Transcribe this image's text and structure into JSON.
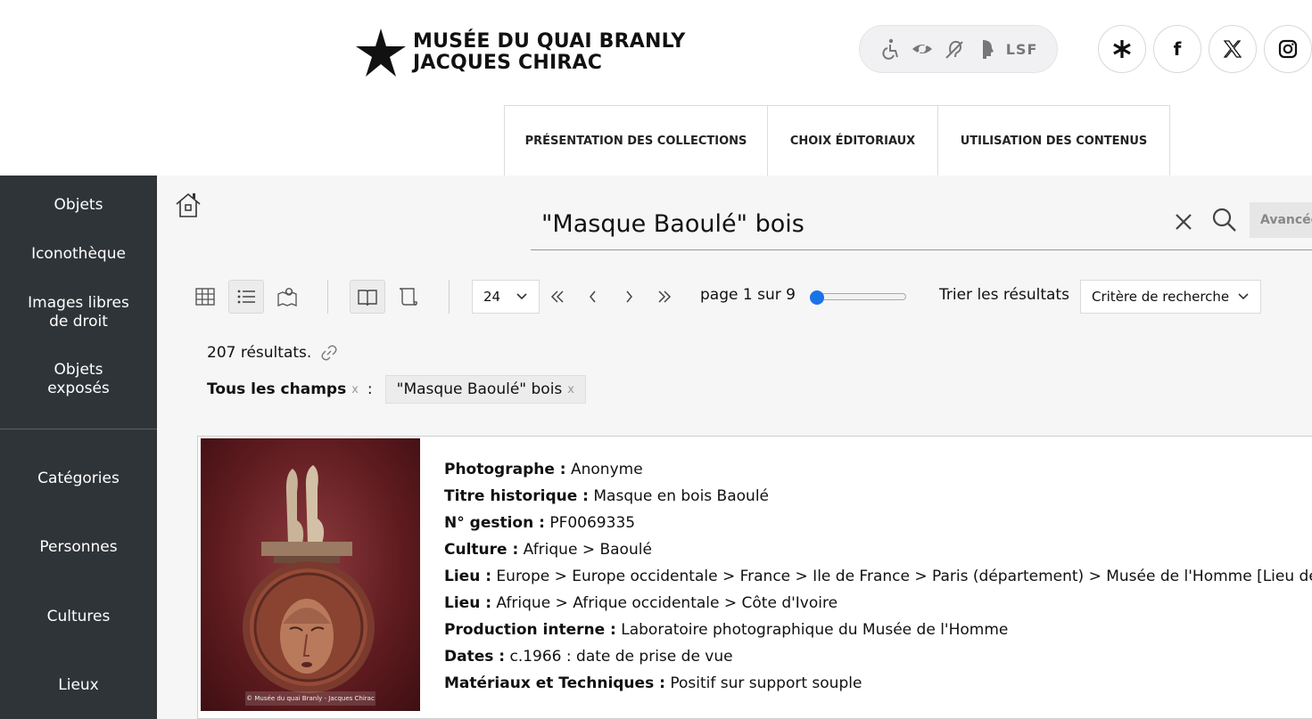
{
  "header": {
    "logo_line1": "MUSÉE DU QUAI BRANLY",
    "logo_line2": "JACQUES CHIRAC",
    "accessibility": [
      "wheelchair-icon",
      "low-vision-icon",
      "hearing-icon",
      "cognitive-icon"
    ],
    "lsf_label": "LSF",
    "social": [
      "linktree-icon",
      "facebook-icon",
      "x-icon",
      "instagram-icon"
    ],
    "facebook_glyph": "f"
  },
  "topnav": [
    {
      "label": "PRÉSENTATION DES COLLECTIONS"
    },
    {
      "label": "CHOIX ÉDITORIAUX"
    },
    {
      "label": "UTILISATION DES CONTENUS"
    }
  ],
  "sidebar": {
    "items": [
      {
        "label": "Objets"
      },
      {
        "label": "Iconothèque"
      },
      {
        "label": "Images libres de droit"
      },
      {
        "label": "Objets exposés"
      },
      {
        "label": "Catégories"
      },
      {
        "label": "Personnes"
      },
      {
        "label": "Cultures"
      },
      {
        "label": "Lieux"
      }
    ]
  },
  "search": {
    "value": "\"Masque Baoulé\" bois",
    "advanced_label": "Avancée"
  },
  "toolbar": {
    "view_icons": [
      "grid-view-icon",
      "list-view-icon",
      "map-view-icon"
    ],
    "mode_icons": [
      "book-icon",
      "scroll-icon"
    ],
    "per_page": "24",
    "page_label": "page 1 sur 9",
    "page_current": 1,
    "page_total": 9,
    "sort_label": "Trier les résultats",
    "sort_value": "Critère de recherche"
  },
  "results": {
    "count_text": "207 résultats.",
    "filter_label": "Tous les champs",
    "filter_remove": "x",
    "filter_colon": ":",
    "chip_value": "\"Masque Baoulé\" bois",
    "chip_remove": "x"
  },
  "record": {
    "image_caption": "© Musée du quai Branly - Jacques Chirac",
    "fields": [
      {
        "label": "Photographe :",
        "value": "Anonyme"
      },
      {
        "label": "Titre historique :",
        "value": "Masque en bois Baoulé"
      },
      {
        "label": "N° gestion :",
        "value": "PF0069335"
      },
      {
        "label": "Culture :",
        "value": "Afrique  >  Baoulé"
      },
      {
        "label": "Lieu :",
        "value": "Europe  >  Europe occidentale  >  France  >  Ile de France  >  Paris (département)  >  Musée de l'Homme [Lieu de pr"
      },
      {
        "label": "Lieu :",
        "value": "Afrique  >  Afrique occidentale  >  Côte d'Ivoire"
      },
      {
        "label": "Production interne :",
        "value": "Laboratoire photographique du Musée de l'Homme"
      },
      {
        "label": "Dates :",
        "value": "c.1966 : date de prise de vue"
      },
      {
        "label": "Matériaux et Techniques :",
        "value": "Positif sur support souple"
      }
    ]
  },
  "colors": {
    "sidebar_bg": "#2f3438",
    "main_bg": "#f6f6f6",
    "accent": "#1a73e8"
  }
}
